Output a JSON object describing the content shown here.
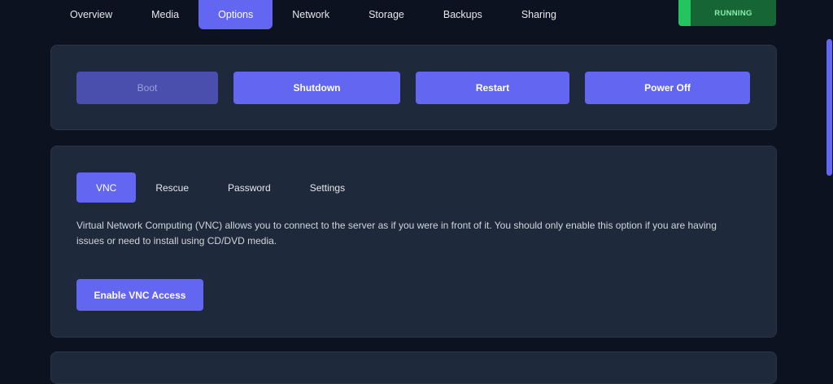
{
  "nav": {
    "tabs": [
      {
        "label": "Overview"
      },
      {
        "label": "Media"
      },
      {
        "label": "Options",
        "active": true
      },
      {
        "label": "Network"
      },
      {
        "label": "Storage"
      },
      {
        "label": "Backups"
      },
      {
        "label": "Sharing"
      }
    ]
  },
  "status": {
    "label": "RUNNING",
    "color": "#22c55e"
  },
  "power": {
    "boot_label": "Boot",
    "shutdown_label": "Shutdown",
    "restart_label": "Restart",
    "poweroff_label": "Power Off"
  },
  "console": {
    "tabs": [
      {
        "label": "VNC",
        "active": true
      },
      {
        "label": "Rescue"
      },
      {
        "label": "Password"
      },
      {
        "label": "Settings"
      }
    ],
    "description": "Virtual Network Computing (VNC) allows you to connect to the server as if you were in front of it. You should only enable this option if you are having issues or need to install using CD/DVD media.",
    "enable_label": "Enable VNC Access"
  },
  "colors": {
    "accent": "#6366f1",
    "background": "#0c1220",
    "panel": "#1e293b"
  }
}
